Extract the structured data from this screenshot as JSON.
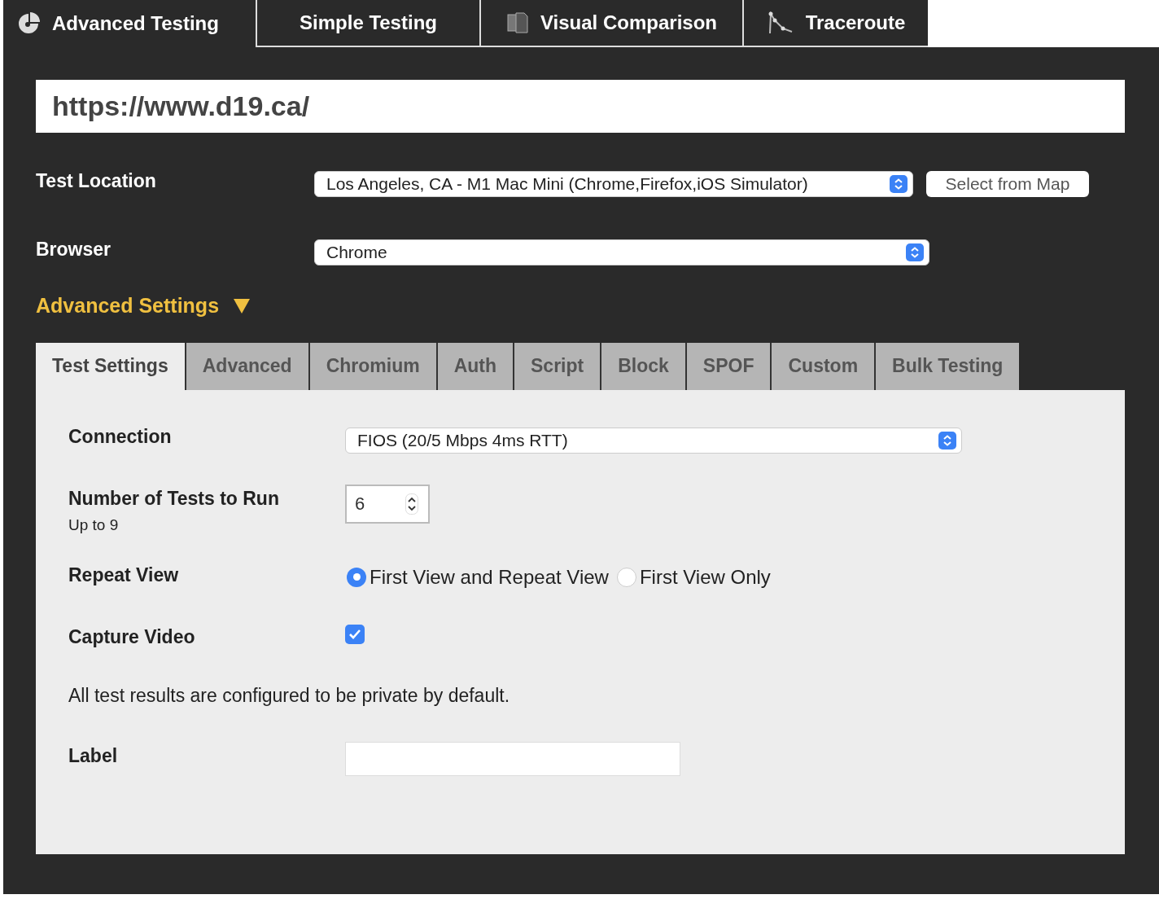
{
  "top_tabs": [
    {
      "label": "Advanced Testing",
      "selected": true
    },
    {
      "label": "Simple Testing",
      "selected": false
    },
    {
      "label": "Visual Comparison",
      "selected": false
    },
    {
      "label": "Traceroute",
      "selected": false
    }
  ],
  "url_field": {
    "value": "https://www.d19.ca/"
  },
  "test_location": {
    "label": "Test Location",
    "value": "Los Angeles, CA - M1 Mac Mini (Chrome,Firefox,iOS Simulator)",
    "map_button": "Select from Map"
  },
  "browser": {
    "label": "Browser",
    "value": "Chrome"
  },
  "advanced_settings": {
    "label": "Advanced Settings",
    "expanded": true
  },
  "settings_tabs": [
    {
      "label": "Test Settings",
      "selected": true
    },
    {
      "label": "Advanced",
      "selected": false
    },
    {
      "label": "Chromium",
      "selected": false
    },
    {
      "label": "Auth",
      "selected": false
    },
    {
      "label": "Script",
      "selected": false
    },
    {
      "label": "Block",
      "selected": false
    },
    {
      "label": "SPOF",
      "selected": false
    },
    {
      "label": "Custom",
      "selected": false
    },
    {
      "label": "Bulk Testing",
      "selected": false
    }
  ],
  "connection": {
    "label": "Connection",
    "value": "FIOS (20/5 Mbps 4ms RTT)"
  },
  "number_of_tests": {
    "label": "Number of Tests to Run",
    "hint": "Up to 9",
    "value": "6"
  },
  "repeat_view": {
    "label": "Repeat View",
    "options": [
      {
        "label": "First View and Repeat View",
        "selected": true
      },
      {
        "label": "First View Only",
        "selected": false
      }
    ]
  },
  "capture_video": {
    "label": "Capture Video",
    "checked": true
  },
  "privacy_note": "All test results are configured to be private by default.",
  "label_field": {
    "label": "Label"
  }
}
